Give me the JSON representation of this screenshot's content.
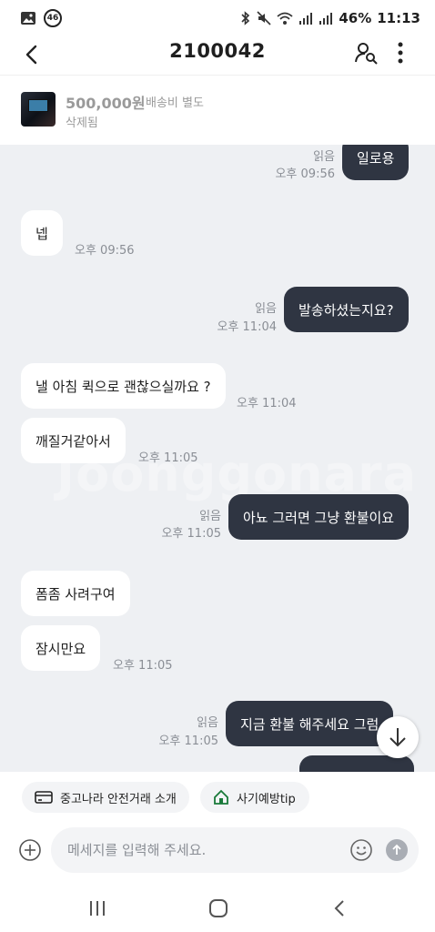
{
  "status": {
    "sim_badge": "46",
    "battery": "46%",
    "time": "11:13"
  },
  "header": {
    "title": "2100042"
  },
  "product": {
    "price": "500,000원",
    "shipping": "배송비 별도",
    "state": "삭제됨"
  },
  "watermark": "Joonggonara",
  "messages": [
    {
      "dir": "out",
      "text": "일로용",
      "read": "읽음",
      "time": "오후 09:56"
    },
    {
      "dir": "in",
      "text": "넵",
      "time": "오후 09:56"
    },
    {
      "dir": "out",
      "text": "발송하셨는지요?",
      "read": "읽음",
      "time": "오후 11:04"
    },
    {
      "dir": "in",
      "text": "낼 아침 퀵으로 괜찮으실까요 ?",
      "time": "오후 11:04"
    },
    {
      "dir": "in",
      "text": "깨질거같아서",
      "time": "오후 11:05"
    },
    {
      "dir": "out",
      "text": "아뇨 그러면 그냥 환불이요",
      "read": "읽음",
      "time": "오후 11:05"
    },
    {
      "dir": "in",
      "text": "폼좀 사려구여",
      "time": ""
    },
    {
      "dir": "in",
      "text": "잠시만요",
      "time": "오후 11:05"
    },
    {
      "dir": "out",
      "text": "지금 환불 해주세요 그럼",
      "read": "읽음",
      "time": "오후 11:05"
    }
  ],
  "chips": {
    "safe_trade": "중고나라 안전거래 소개",
    "fraud_tip": "사기예방tip"
  },
  "composer": {
    "placeholder": "메세지를 입력해 주세요."
  },
  "colors": {
    "out_bubble": "#2f3542",
    "in_bubble": "#ffffff",
    "chat_bg": "#eef0f3"
  }
}
